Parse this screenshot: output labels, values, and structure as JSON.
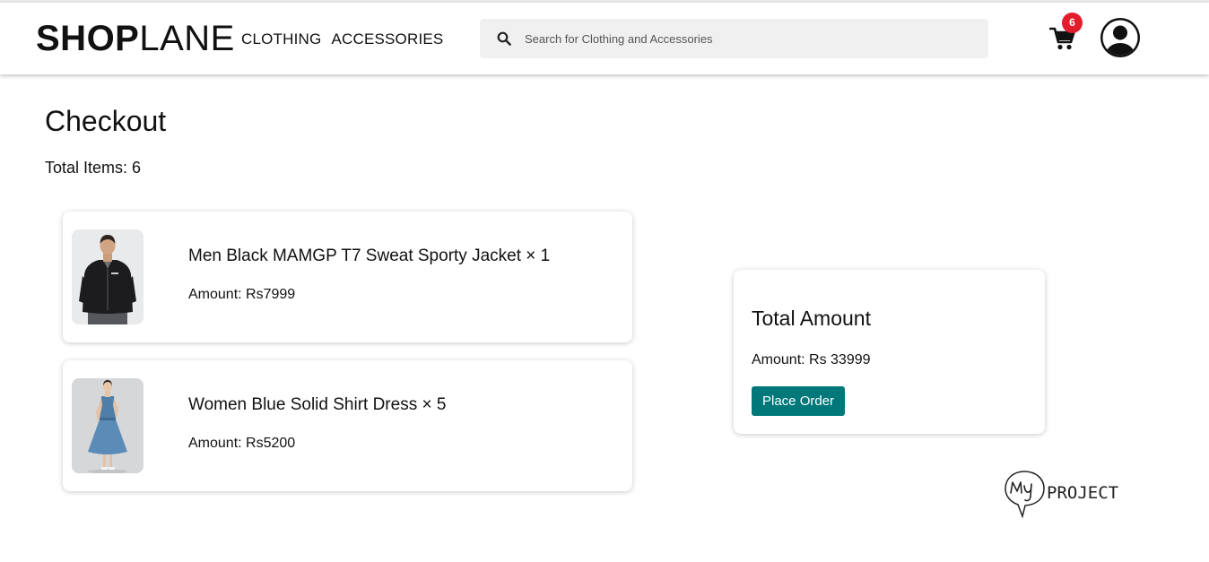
{
  "header": {
    "logo_bold": "SHOP",
    "logo_light": "LANE",
    "nav": [
      "CLOTHING",
      "ACCESSORIES"
    ],
    "search_placeholder": "Search for Clothing and Accessories",
    "cart_count": "6"
  },
  "page": {
    "title": "Checkout",
    "total_items": "Total Items: 6"
  },
  "items": [
    {
      "name": "Men Black MAMGP T7 Sweat Sporty Jacket × 1",
      "amount": "Amount: Rs7999",
      "image": "men-black-jacket"
    },
    {
      "name": "Women Blue Solid Shirt Dress × 5",
      "amount": "Amount: Rs5200",
      "image": "women-blue-dress"
    }
  ],
  "summary": {
    "title": "Total Amount",
    "amount": "Amount: Rs 33999",
    "button": "Place Order"
  },
  "colors": {
    "accent": "#00787a",
    "badge": "#e21d2c"
  },
  "icons": [
    "search-icon",
    "cart-icon",
    "user-avatar-icon"
  ],
  "watermark": "PROJECT"
}
